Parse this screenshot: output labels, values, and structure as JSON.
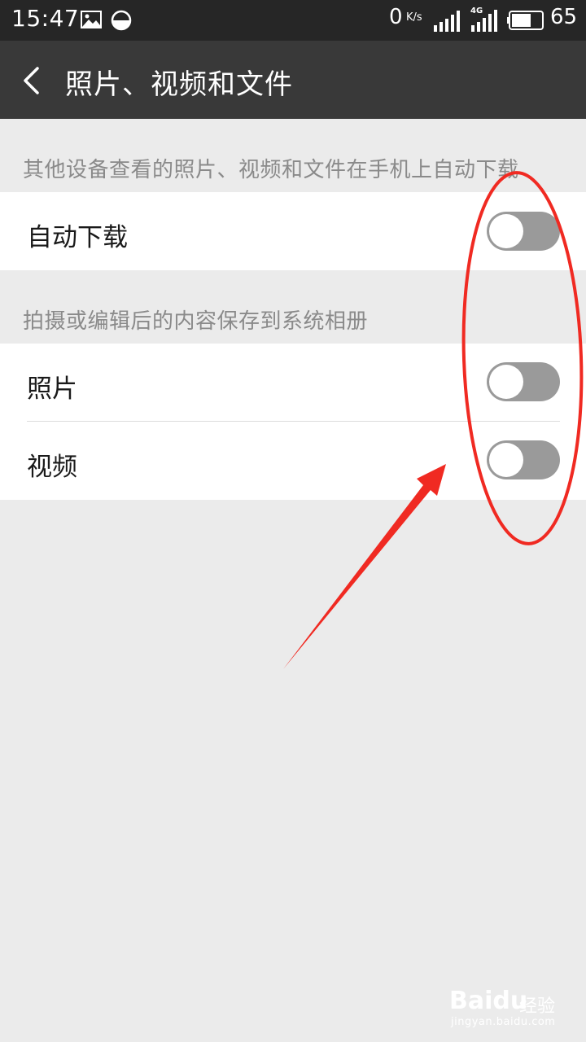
{
  "status_bar": {
    "time": "15:47",
    "speed_value": "0",
    "speed_unit": "K/s",
    "network": "4G",
    "battery_percent": "65",
    "battery_level": 0.65,
    "icons": [
      "image-icon",
      "data-saver-icon",
      "signal-icon",
      "signal-4g-icon",
      "battery-icon"
    ]
  },
  "title_bar": {
    "back_icon": "chevron-left-icon",
    "title": "照片、视频和文件"
  },
  "sections": [
    {
      "header": "其他设备查看的照片、视频和文件在手机上自动下载",
      "rows": [
        {
          "label": "自动下载",
          "enabled": false
        }
      ]
    },
    {
      "header": "拍摄或编辑后的内容保存到系统相册",
      "rows": [
        {
          "label": "照片",
          "enabled": false
        },
        {
          "label": "视频",
          "enabled": false
        }
      ]
    }
  ],
  "colors": {
    "status_bar_bg": "#262626",
    "title_bar_bg": "#393939",
    "page_bg": "#ebebeb",
    "switch_off": "#9a9a9a",
    "annotation": "#f02a22"
  },
  "watermark": {
    "brand": "Baidu",
    "suffix": "经验",
    "domain": "jingyan.baidu.com"
  }
}
